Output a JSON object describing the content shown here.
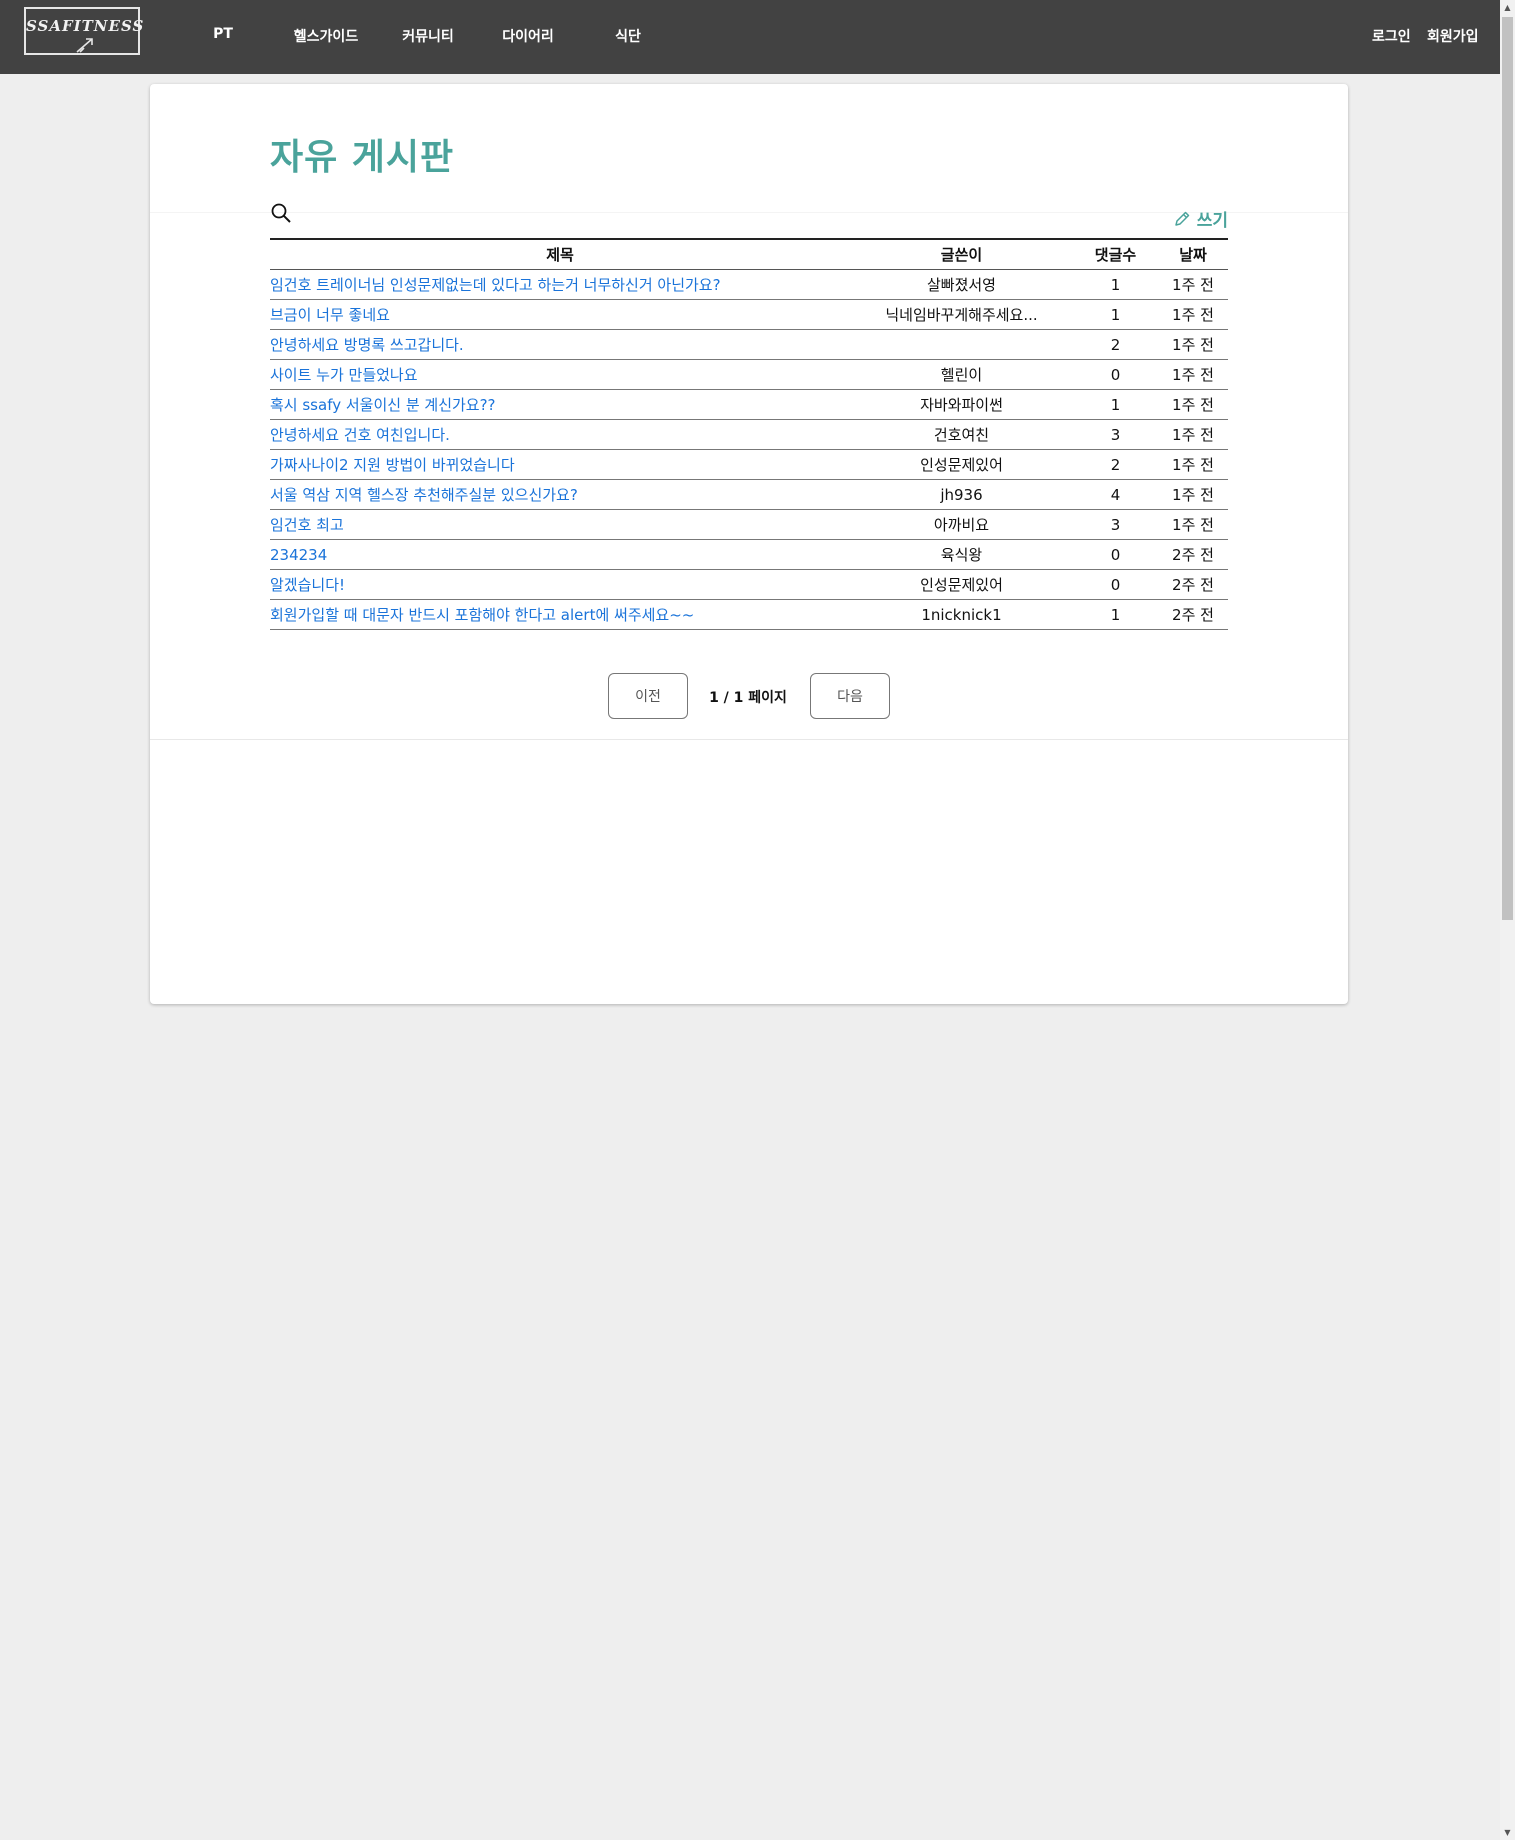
{
  "header": {
    "logo_text": "SSAFITNESS",
    "nav": [
      "PT",
      "헬스가이드",
      "커뮤니티",
      "다이어리",
      "식단"
    ],
    "login_label": "로그인",
    "signup_label": "회원가입"
  },
  "board": {
    "title": "자유 게시판",
    "write_label": "쓰기",
    "columns": [
      "제목",
      "글쓴이",
      "댓글수",
      "날짜"
    ],
    "rows": [
      {
        "title": "임건호 트레이너님 인성문제없는데 있다고 하는거 너무하신거 아닌가요?",
        "author": "살빠졌서영",
        "comments": "1",
        "date": "1주 전"
      },
      {
        "title": "브금이 너무 좋네요",
        "author": "닉네임바꾸게해주세요...",
        "comments": "1",
        "date": "1주 전"
      },
      {
        "title": "안녕하세요 방명록 쓰고갑니다.",
        "author": "",
        "comments": "2",
        "date": "1주 전"
      },
      {
        "title": "사이트 누가 만들었나요",
        "author": "헬린이",
        "comments": "0",
        "date": "1주 전"
      },
      {
        "title": "혹시 ssafy 서울이신 분 계신가요??",
        "author": "자바와파이썬",
        "comments": "1",
        "date": "1주 전"
      },
      {
        "title": "안녕하세요 건호 여친입니다.",
        "author": "건호여친",
        "comments": "3",
        "date": "1주 전"
      },
      {
        "title": "가짜사나이2 지원 방법이 바뀌었습니다",
        "author": "인성문제있어",
        "comments": "2",
        "date": "1주 전"
      },
      {
        "title": "서울 역삼 지역 헬스장 추천해주실분 있으신가요?",
        "author": "jh936",
        "comments": "4",
        "date": "1주 전"
      },
      {
        "title": "임건호 최고",
        "author": "아까비요",
        "comments": "3",
        "date": "1주 전"
      },
      {
        "title": "234234",
        "author": "육식왕",
        "comments": "0",
        "date": "2주 전"
      },
      {
        "title": "알겠습니다!",
        "author": "인성문제있어",
        "comments": "0",
        "date": "2주 전"
      },
      {
        "title": "회원가입할 때 대문자 반드시 포함해야 한다고 alert에 써주세요~~",
        "author": "1nicknick1",
        "comments": "1",
        "date": "2주 전"
      }
    ]
  },
  "pagination": {
    "prev_label": "이전",
    "next_label": "다음",
    "info": "1 / 1 페이지"
  },
  "colors": {
    "header_bg": "#424242",
    "accent": "#4aa39b",
    "link": "#1a73d9",
    "page_bg": "#eeeeee"
  },
  "icons": [
    "logo-arrow-icon",
    "search-icon",
    "pencil-icon",
    "scroll-up-icon",
    "scroll-down-icon"
  ]
}
